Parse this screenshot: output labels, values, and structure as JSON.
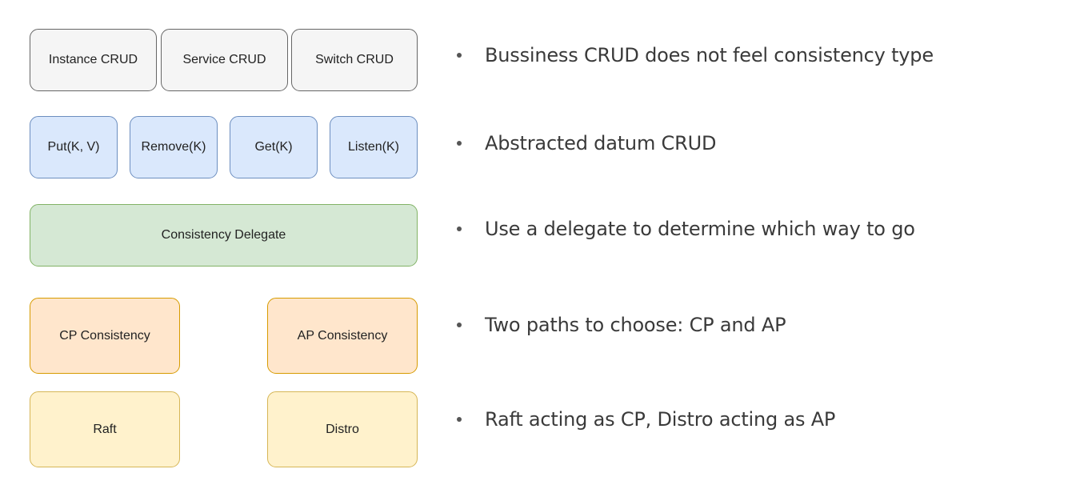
{
  "diagram": {
    "layers": [
      {
        "name": "business",
        "fill": "#f5f5f5",
        "stroke": "#666666",
        "boxes": [
          "Instance CRUD",
          "Service CRUD",
          "Switch CRUD"
        ]
      },
      {
        "name": "datum",
        "fill": "#dae8fc",
        "stroke": "#6c8ebf",
        "boxes": [
          "Put(K, V)",
          "Remove(K)",
          "Get(K)",
          "Listen(K)"
        ]
      },
      {
        "name": "delegate",
        "fill": "#d5e8d4",
        "stroke": "#82b366",
        "boxes": [
          "Consistency Delegate"
        ]
      },
      {
        "name": "consistency",
        "fill": "#ffe6cc",
        "stroke": "#d79b00",
        "boxes": [
          "CP Consistency",
          "AP Consistency"
        ]
      },
      {
        "name": "protocol",
        "fill": "#fff2cc",
        "stroke": "#d6b656",
        "boxes": [
          "Raft",
          "Distro"
        ]
      }
    ]
  },
  "bullets": [
    "Bussiness CRUD does not feel consistency type",
    "Abstracted datum CRUD",
    "Use a delegate to determine which way to go",
    "Two paths to choose: CP and AP",
    "Raft acting as CP, Distro acting as AP"
  ]
}
